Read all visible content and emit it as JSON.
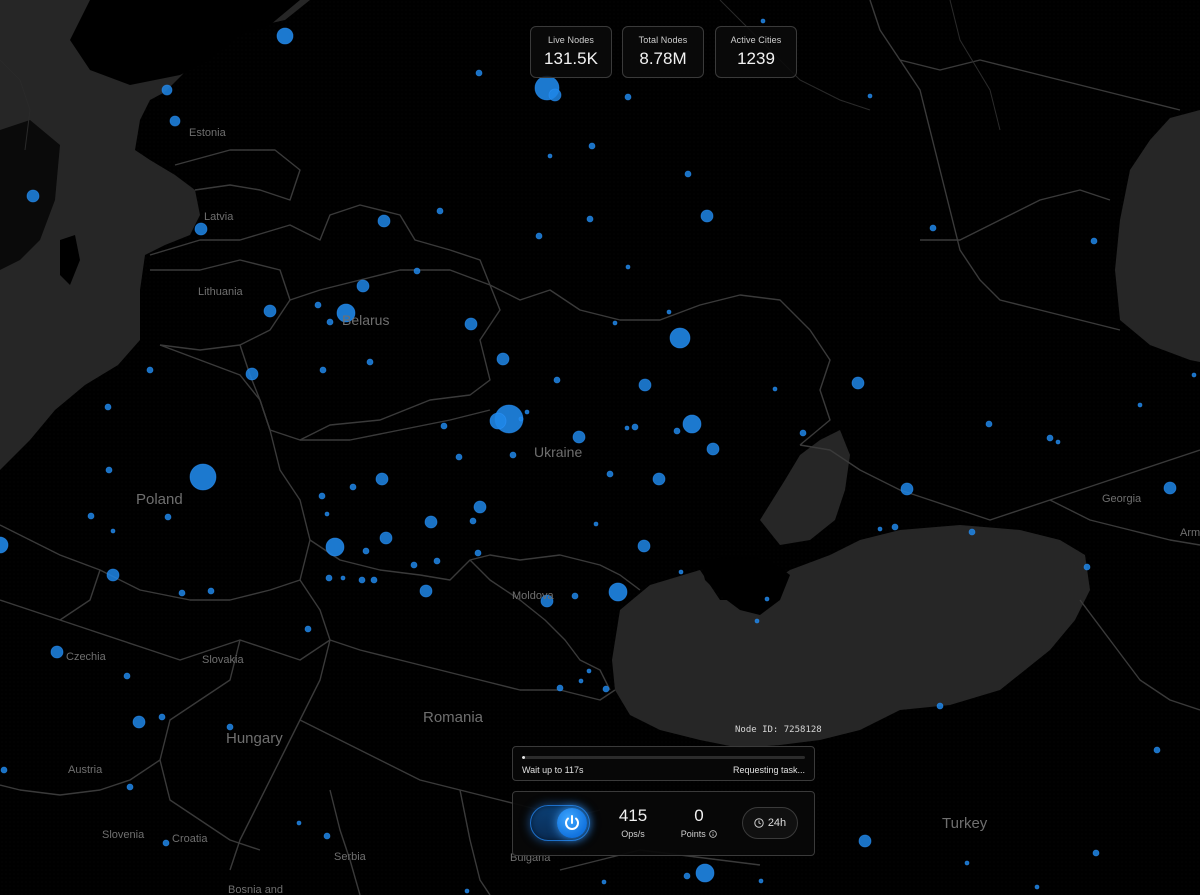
{
  "stats": {
    "live_nodes": {
      "label": "Live Nodes",
      "value": "131.5K"
    },
    "total_nodes": {
      "label": "Total Nodes",
      "value": "8.78M"
    },
    "active_cities": {
      "label": "Active Cities",
      "value": "1239"
    }
  },
  "map": {
    "country_labels": [
      "Estonia",
      "Latvia",
      "Lithuania",
      "Belarus",
      "Ukraine",
      "Poland",
      "Georgia",
      "Arm",
      "Moldova",
      "Czechia",
      "Slovakia",
      "Romania",
      "Hungary",
      "Austria",
      "Slovenia",
      "Croatia",
      "Serbia",
      "Bulgaria",
      "Bosnia and",
      "Turkey"
    ],
    "node_color": "#1f86e6",
    "land_color": "#000000",
    "water_color": "#262626",
    "border_color": "#3a3a3a"
  },
  "node": {
    "id_label": "Node ID: 7258128"
  },
  "task": {
    "progress_fraction": 0.01,
    "wait_text": "Wait up to 117s",
    "status": "Requesting task..."
  },
  "controls": {
    "power_on": true,
    "power_icon": "power-icon",
    "ops": {
      "value": "415",
      "label": "Ops/s"
    },
    "points": {
      "value": "0",
      "label": "Points",
      "info_icon": "info-icon"
    },
    "period": {
      "label": "24h",
      "icon": "clock-icon"
    }
  }
}
